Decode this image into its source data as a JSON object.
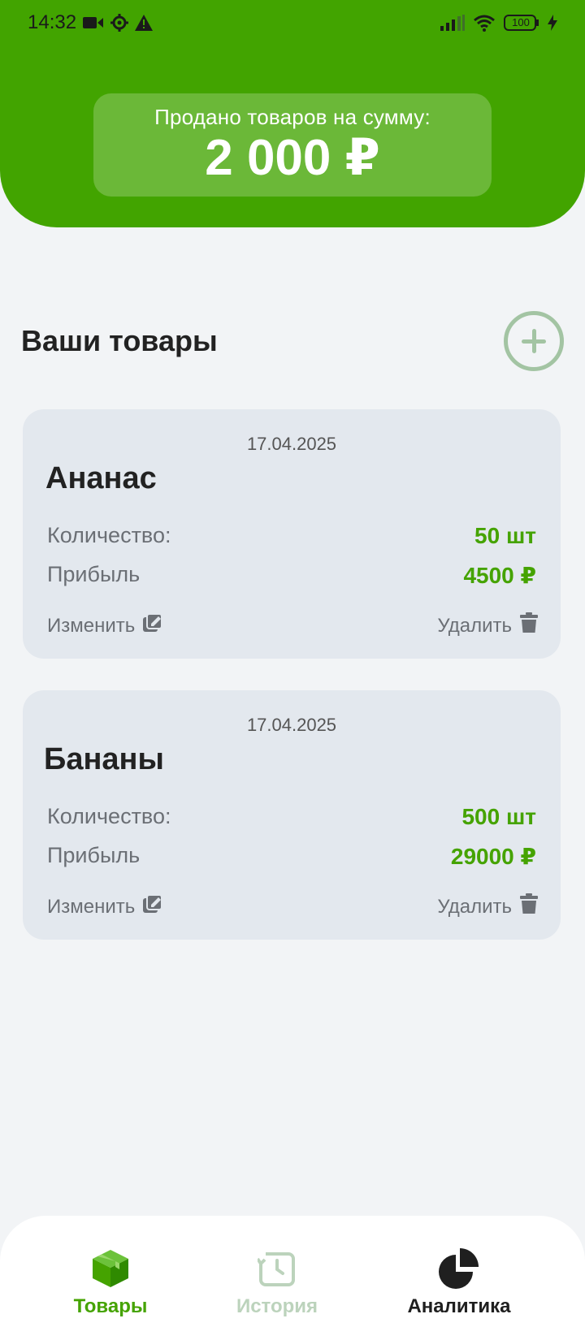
{
  "status_bar": {
    "time": "14:32",
    "battery": "100",
    "icons": [
      "video-icon",
      "settings-gear-icon",
      "warning-icon",
      "signal-icon",
      "wifi-icon",
      "battery-icon",
      "charging-icon"
    ]
  },
  "summary": {
    "label": "Продано товаров на сумму:",
    "value": "2 000 ₽"
  },
  "section": {
    "title": "Ваши товары"
  },
  "products": [
    {
      "date": "17.04.2025",
      "name": "Ананас",
      "quantity_label": "Количество:",
      "quantity_value": "50 шт",
      "profit_label": "Прибыль",
      "profit_value": "4500 ₽",
      "edit_label": "Изменить",
      "delete_label": "Удалить"
    },
    {
      "date": "17.04.2025",
      "name": "Бананы",
      "quantity_label": "Количество:",
      "quantity_value": "500 шт",
      "profit_label": "Прибыль",
      "profit_value": "29000 ₽",
      "edit_label": "Изменить",
      "delete_label": "Удалить"
    }
  ],
  "nav": {
    "items": [
      {
        "label": "Товары",
        "icon": "box-icon",
        "state": "active"
      },
      {
        "label": "История",
        "icon": "history-icon",
        "state": "inactive"
      },
      {
        "label": "Аналитика",
        "icon": "pie-chart-icon",
        "state": "default"
      }
    ]
  },
  "colors": {
    "brand_green": "#42a400",
    "value_green": "#45a300",
    "card_bg": "#e3e8ee",
    "page_bg": "#f2f4f6"
  }
}
